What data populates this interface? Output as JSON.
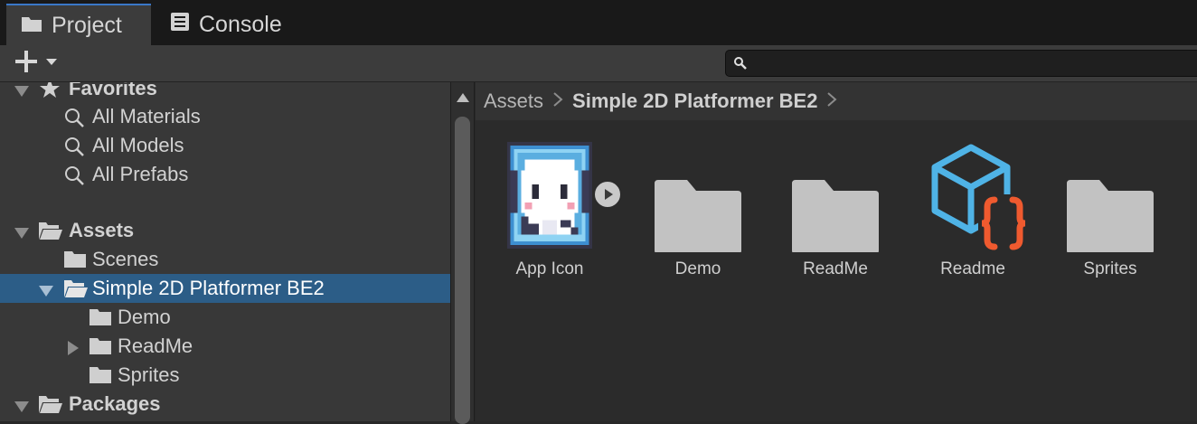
{
  "tabs": [
    {
      "label": "Project",
      "icon": "folder-icon",
      "active": true
    },
    {
      "label": "Console",
      "icon": "console-icon",
      "active": false
    }
  ],
  "toolbar": {
    "add_icon": "plus-icon",
    "search": {
      "value": "",
      "placeholder": ""
    }
  },
  "tree": {
    "items": [
      {
        "label": "Favorites",
        "icon": "star-icon",
        "bold": true,
        "expanded": true
      },
      {
        "label": "All Materials",
        "icon": "search-icon"
      },
      {
        "label": "All Models",
        "icon": "search-icon"
      },
      {
        "label": "All Prefabs",
        "icon": "search-icon"
      },
      {
        "label": "Assets",
        "icon": "folder-open-icon",
        "bold": true,
        "expanded": true
      },
      {
        "label": "Scenes",
        "icon": "folder-icon"
      },
      {
        "label": "Simple 2D Platformer BE2",
        "icon": "folder-open-icon",
        "expanded": true,
        "selected": true
      },
      {
        "label": "Demo",
        "icon": "folder-icon"
      },
      {
        "label": "ReadMe",
        "icon": "folder-icon",
        "collapsed": true
      },
      {
        "label": "Sprites",
        "icon": "folder-icon"
      },
      {
        "label": "Packages",
        "icon": "folder-open-icon",
        "bold": true,
        "expanded": true
      }
    ]
  },
  "breadcrumb": {
    "items": [
      "Assets",
      "Simple 2D Platformer BE2"
    ]
  },
  "grid": {
    "items": [
      {
        "label": "App Icon",
        "type": "sprite",
        "icon": "app-icon-sprite"
      },
      {
        "label": "Demo",
        "type": "folder",
        "icon": "folder-icon"
      },
      {
        "label": "ReadMe",
        "type": "folder",
        "icon": "folder-icon"
      },
      {
        "label": "Readme",
        "type": "script-asset",
        "icon": "script-asset-icon"
      },
      {
        "label": "Sprites",
        "type": "folder",
        "icon": "folder-icon"
      }
    ]
  },
  "colors": {
    "selection": "#2c5d87",
    "accent_tab": "#3a78c8",
    "folder": "#c2c2c2",
    "asset_icon_blue": "#4fb3e6",
    "asset_icon_orange": "#ef5a2f"
  }
}
